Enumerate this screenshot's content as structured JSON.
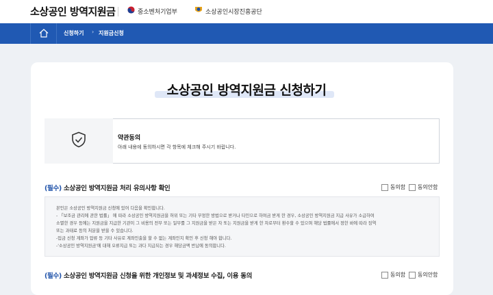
{
  "header": {
    "brand": "소상공인 방역지원금",
    "org1": "중소벤처기업부",
    "org2": "소상공인시장진흥공단"
  },
  "nav": {
    "crumb1": "신청하기",
    "crumb2": "지원금신청"
  },
  "page": {
    "title": "소상공인 방역지원금 신청하기"
  },
  "terms": {
    "title": "약관동의",
    "desc": "아래 내용에 동의하시면 각 항목에 체크해 주시기 바랍니다."
  },
  "section1": {
    "required": "(필수)",
    "title": " 소상공인 방역지원금 처리 유의사항 확인",
    "agree": "동의함",
    "disagree": "동의안함",
    "lines": [
      "본인은 소상공인 방역지원금 신청에 있어 다음을 확인합니다.",
      "- 「보조금 관리에 관한 법률」 에 따라 소상공인 방역지원금을 허위 또는 기타 부정한 방법으로 받거나 타인으로 하여금 받게 한 경우, 소상공인 방역지원금 지급 사유가 소급하여",
      "소멸한 경우 등에는 지원금을 지급한 기관이 그 비용의 전부 또는 일부를 그 지원금을 받은 자 또는 지원금을 받게 한 자로부터 환수할 수 있으며 해당 법률에서 정한 바에 따라 징역",
      "또는 과태료 등의 처분을 받을 수 있습니다.",
      "-입금 신청 계좌가 압류 등 기타 사유로 계좌인출을 할 수 없는 계좌인지 확인 후 신청 해야 합니다.",
      "-'소상공인 방역지원금'에 대해 오류지급 또는 과다 지급되는 경우 해당금액 반납에 동의합니다."
    ]
  },
  "section2": {
    "required": "(필수)",
    "title": " 소상공인 방역지원금 신청을 위한 개인정보 및 과세정보 수집, 이용 동의",
    "agree": "동의함",
    "disagree": "동의안함"
  }
}
